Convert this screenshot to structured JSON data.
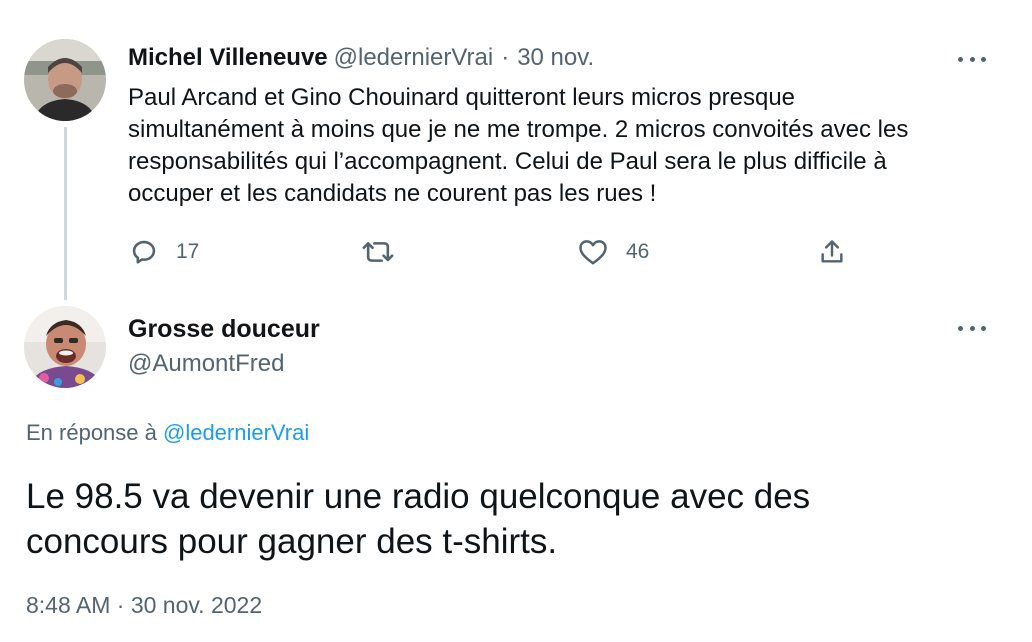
{
  "parent_tweet": {
    "author_name": "Michel Villeneuve",
    "handle": "@ledernierVrai",
    "separator": "·",
    "date": "30 nov.",
    "text_lines": [
      "Paul Arcand et Gino Chouinard quitteront leurs micros presque",
      "simultanément à moins que je ne me trompe.  2 micros convoités avec les",
      "responsabilités qui l’accompagnent.  Celui de Paul sera le plus difficile à",
      "occuper et les candidats ne courent pas les rues !"
    ],
    "actions": {
      "reply": {
        "icon": "reply-icon",
        "count": "17"
      },
      "retweet": {
        "icon": "retweet-icon",
        "count": ""
      },
      "like": {
        "icon": "heart-icon",
        "count": "46"
      },
      "share": {
        "icon": "share-icon",
        "count": ""
      }
    },
    "more_icon": "more-horizontal-icon"
  },
  "focused_tweet": {
    "author_name": "Grosse douceur",
    "handle": "@AumontFred",
    "reply_prefix": "En réponse à ",
    "reply_to": "@ledernierVrai",
    "text_lines": [
      "Le 98.5 va devenir une radio quelconque avec des",
      "concours pour gagner des t-shirts."
    ],
    "timestamp": "8:48 AM · 30 nov. 2022",
    "more_icon": "more-horizontal-icon"
  },
  "colors": {
    "text_primary": "#0f1419",
    "text_secondary": "#536471",
    "link": "#1d9bf0",
    "thread_line": "#cfd9de"
  }
}
